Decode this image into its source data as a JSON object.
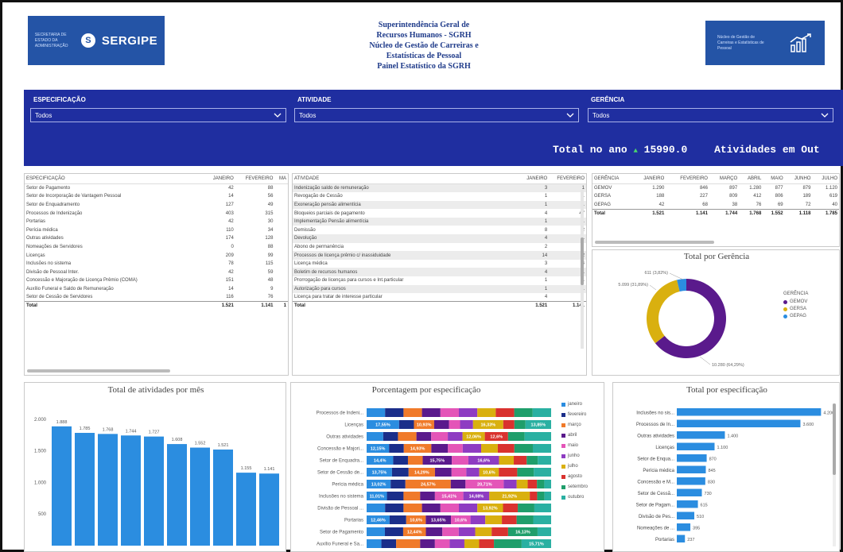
{
  "header": {
    "left_logo_small": "SECRETARIA DE ESTADO DA ADMINISTRAÇÃO",
    "left_logo_brand": "SERGIPE",
    "right_logo_small": "Núcleo de Gestão de Carreiras e Estatísticas de Pessoal",
    "title_lines": [
      "Superintendência Geral de",
      "Recursos Humanos - SGRH",
      "Núcleo de Gestão de Carreiras e",
      "Estatísticas de Pessoal",
      "Painel Estatístico da SGRH"
    ]
  },
  "filters": [
    {
      "label": "ESPECIFICAÇÃO",
      "value": "Todos"
    },
    {
      "label": "ATIVIDADE",
      "value": "Todos"
    },
    {
      "label": "GERÊNCIA",
      "value": "Todos"
    }
  ],
  "totals": {
    "label": "Total no ano",
    "arrow": "▲",
    "value": "15990.0",
    "other": "Atividades em Out"
  },
  "spec_table": {
    "headers": [
      "ESPECIFICAÇÃO",
      "JANEIRO",
      "FEVEREIRO",
      "MA"
    ],
    "rows": [
      [
        "Setor de Pagamento",
        "42",
        "88",
        ""
      ],
      [
        "Setor de Incorporação de Vantagem Pessoal",
        "14",
        "56",
        ""
      ],
      [
        "Setor de Enquadramento",
        "127",
        "49",
        ""
      ],
      [
        "Processos de Indenização",
        "403",
        "315",
        ""
      ],
      [
        "Portarias",
        "42",
        "30",
        ""
      ],
      [
        "Perícia médica",
        "110",
        "34",
        ""
      ],
      [
        "Outras atividades",
        "174",
        "128",
        ""
      ],
      [
        "Nomeações de Servidores",
        "0",
        "88",
        ""
      ],
      [
        "Licenças",
        "209",
        "99",
        ""
      ],
      [
        "Inclusões no sistema",
        "78",
        "115",
        ""
      ],
      [
        "Divisão de Pessoal Inter.",
        "42",
        "59",
        ""
      ],
      [
        "Concessão e Majoração de Licença Prêmio (COMA)",
        "151",
        "48",
        ""
      ],
      [
        "Auxílio Funeral e Saldo de Remuneração",
        "14",
        "9",
        ""
      ],
      [
        "Setor de Cessão de Servidores",
        "116",
        "76",
        ""
      ]
    ],
    "total": [
      "Total",
      "1.521",
      "1.141",
      "1"
    ]
  },
  "activity_table": {
    "headers": [
      "ATIVIDADE",
      "JANEIRO",
      "FEVEREIRO"
    ],
    "rows": [
      [
        "Indenização saldo de remuneração",
        "3",
        "1"
      ],
      [
        "Revogação de Cessão",
        "1",
        "1"
      ],
      [
        "Exoneração pensão alimentícia",
        "1",
        "1"
      ],
      [
        "Bloqueios parciais de pagamento",
        "4",
        "47"
      ],
      [
        "Implementação Pensão alimentícia",
        "1",
        "1"
      ],
      [
        "Demissão",
        "8",
        "2"
      ],
      [
        "Devolução",
        "4",
        "1"
      ],
      [
        "Abono de permanência",
        "2",
        ""
      ],
      [
        "Processos de licença prêmio c/ inassiduidade",
        "14",
        "2"
      ],
      [
        "Licença médica",
        "3",
        "4"
      ],
      [
        "Boletim de recursos humanos",
        "4",
        "1"
      ],
      [
        "Prorrogação de licenças para cursos e Int.particular",
        "1",
        "1"
      ],
      [
        "Autorização para cursos",
        "1",
        "1"
      ],
      [
        "Licença para tratar de interesse particular",
        "4",
        ""
      ]
    ],
    "total": [
      "Total",
      "1.521",
      "1.141"
    ]
  },
  "gerencia_table": {
    "headers": [
      "GERÊNCIA",
      "JANEIRO",
      "FEVEREIRO",
      "MARÇO",
      "ABRIL",
      "MAIO",
      "JUNHO",
      "JULHO"
    ],
    "rows": [
      [
        "GEMOV",
        "1.290",
        "846",
        "897",
        "1.280",
        "877",
        "879",
        "1.120"
      ],
      [
        "GERSA",
        "188",
        "227",
        "809",
        "412",
        "806",
        "189",
        "619"
      ],
      [
        "GEPAG",
        "42",
        "68",
        "38",
        "76",
        "69",
        "72",
        "40"
      ]
    ],
    "total": [
      "Total",
      "1.521",
      "1.141",
      "1.744",
      "1.768",
      "1.552",
      "1.118",
      "1.785"
    ]
  },
  "donut": {
    "title": "Total por Gerência",
    "legend_title": "GERÊNCIA",
    "labels": [
      "611 (3,82%)",
      "5.099 (31,89%)",
      "10.280 (64,29%)"
    ],
    "slices": [
      {
        "name": "GEMOV",
        "value": 10280,
        "color": "#5a1a8c"
      },
      {
        "name": "GERSA",
        "value": 5099,
        "color": "#d9b00f"
      },
      {
        "name": "GEPAG",
        "value": 611,
        "color": "#2b8de0"
      }
    ]
  },
  "monthly_chart": {
    "title": "Total de atividades por mês",
    "type": "bar",
    "yticks": [
      "2.000",
      "1.500",
      "1.000",
      "500"
    ],
    "ylim": [
      0,
      2200
    ],
    "categories": [
      "",
      "",
      "",
      "",
      "",
      "",
      "",
      "",
      "",
      ""
    ],
    "values": [
      1888,
      1785,
      1768,
      1744,
      1727,
      1608,
      1552,
      1521,
      1155,
      1141
    ],
    "labels": [
      "1.888",
      "1.785",
      "1.768",
      "1.744",
      "1.727",
      "1.608",
      "1.552",
      "1.521",
      "1.155",
      "1.141"
    ],
    "color": "#2b8de0"
  },
  "stacked_chart": {
    "title": "Porcentagem por especificação",
    "categories": [
      "Processos de Indeni...",
      "Licenças",
      "Outras atividades",
      "Concessão e Majori...",
      "Setor de Enquadra...",
      "Setor de Cessão de...",
      "Perícia médica",
      "Inclusões no sistema",
      "Divisão de Pessoal ...",
      "Portarias",
      "Setor de Pagamento",
      "Auxílio Funeral e Sa..."
    ],
    "months": [
      {
        "name": "janeiro",
        "color": "#2b8de0"
      },
      {
        "name": "fevereiro",
        "color": "#1b2e8a"
      },
      {
        "name": "março",
        "color": "#f07a2a"
      },
      {
        "name": "abril",
        "color": "#5a1a8c"
      },
      {
        "name": "maio",
        "color": "#e455b8"
      },
      {
        "name": "junho",
        "color": "#8e3cc2"
      },
      {
        "name": "julho",
        "color": "#d9b00f"
      },
      {
        "name": "agosto",
        "color": "#d9322f"
      },
      {
        "name": "setembro",
        "color": "#1f9e6b"
      },
      {
        "name": "outubro",
        "color": "#2ab0a2"
      }
    ],
    "rows": [
      [
        10,
        10,
        10,
        10,
        10,
        10,
        10,
        10,
        10,
        10
      ],
      [
        17.55,
        8,
        10.93,
        8,
        6,
        7,
        16.33,
        6,
        6,
        13.85
      ],
      [
        9,
        8,
        10,
        8,
        9,
        8,
        12.06,
        12.6,
        9,
        14.34
      ],
      [
        12.15,
        8,
        14.93,
        9,
        8,
        10,
        9,
        9,
        10,
        9.92
      ],
      [
        14.4,
        8,
        8,
        15.75,
        9,
        16.6,
        8,
        7,
        6,
        7.25
      ],
      [
        13.75,
        9,
        14.29,
        9,
        8,
        7,
        10.6,
        10,
        9,
        9.36
      ],
      [
        13.02,
        8,
        24.57,
        8,
        20.71,
        7,
        6,
        5,
        4,
        3.7
      ],
      [
        11.01,
        9,
        9,
        8,
        15.41,
        14.08,
        21.92,
        4,
        4,
        3.58
      ],
      [
        10,
        10,
        10,
        10,
        10,
        10,
        13.92,
        8,
        9,
        9.08
      ],
      [
        12.46,
        9,
        10.6,
        13.65,
        10.6,
        8,
        9,
        8,
        9,
        9.69
      ],
      [
        10,
        10,
        12.44,
        9,
        9,
        9,
        9,
        9,
        16.13,
        7.43
      ],
      [
        8,
        8,
        13,
        8,
        8,
        8,
        8,
        8,
        15,
        16
      ]
    ],
    "labels": [
      [],
      [
        [
          "17,55%",
          0
        ],
        [
          "10,93%",
          2
        ],
        [
          "16,33%",
          6
        ],
        [
          "13,85%",
          9
        ]
      ],
      [
        [
          "12,06%",
          6
        ],
        [
          "12,6%",
          7
        ]
      ],
      [
        [
          "12,15%",
          0
        ],
        [
          "14,93%",
          2
        ]
      ],
      [
        [
          "14,4%",
          0
        ],
        [
          "15,75%",
          3
        ],
        [
          "16,6%",
          5
        ]
      ],
      [
        [
          "13,75%",
          0
        ],
        [
          "14,29%",
          2
        ],
        [
          "10,6%",
          6
        ]
      ],
      [
        [
          "13,02%",
          0
        ],
        [
          "24,57%",
          2
        ],
        [
          "20,71%",
          4
        ]
      ],
      [
        [
          "11,01%",
          0
        ],
        [
          "15,41%",
          4
        ],
        [
          "14,08%",
          5
        ],
        [
          "21,92%",
          6
        ]
      ],
      [
        [
          "13,92%",
          6
        ]
      ],
      [
        [
          "12,46%",
          0
        ],
        [
          "10,6%",
          2
        ],
        [
          "13,65%",
          3
        ],
        [
          "10,6%",
          4
        ]
      ],
      [
        [
          "12,44%",
          2
        ],
        [
          "16,13%",
          8
        ]
      ],
      [
        [
          "15,71%",
          9
        ]
      ]
    ]
  },
  "hbar_chart": {
    "title": "Total por especificação",
    "categories": [
      "Inclusões no sis...",
      "Processos de In...",
      "Outras atividades",
      "Licenças",
      "Setor de Enqua...",
      "Perícia médica",
      "Concessão e M...",
      "Setor de Cessã...",
      "Setor de Pagam...",
      "Divisão de Pes...",
      "Nomeações de ...",
      "Portarias"
    ],
    "values": [
      4200,
      3600,
      1400,
      1100,
      870,
      845,
      830,
      730,
      615,
      510,
      395,
      237
    ],
    "labels": [
      "4.200",
      "3.600",
      "1.400",
      "1.100",
      "870",
      "845",
      "830",
      "730",
      "615",
      "510",
      "395",
      "237"
    ],
    "xlim": [
      0,
      4400
    ],
    "color": "#2b8de0"
  }
}
